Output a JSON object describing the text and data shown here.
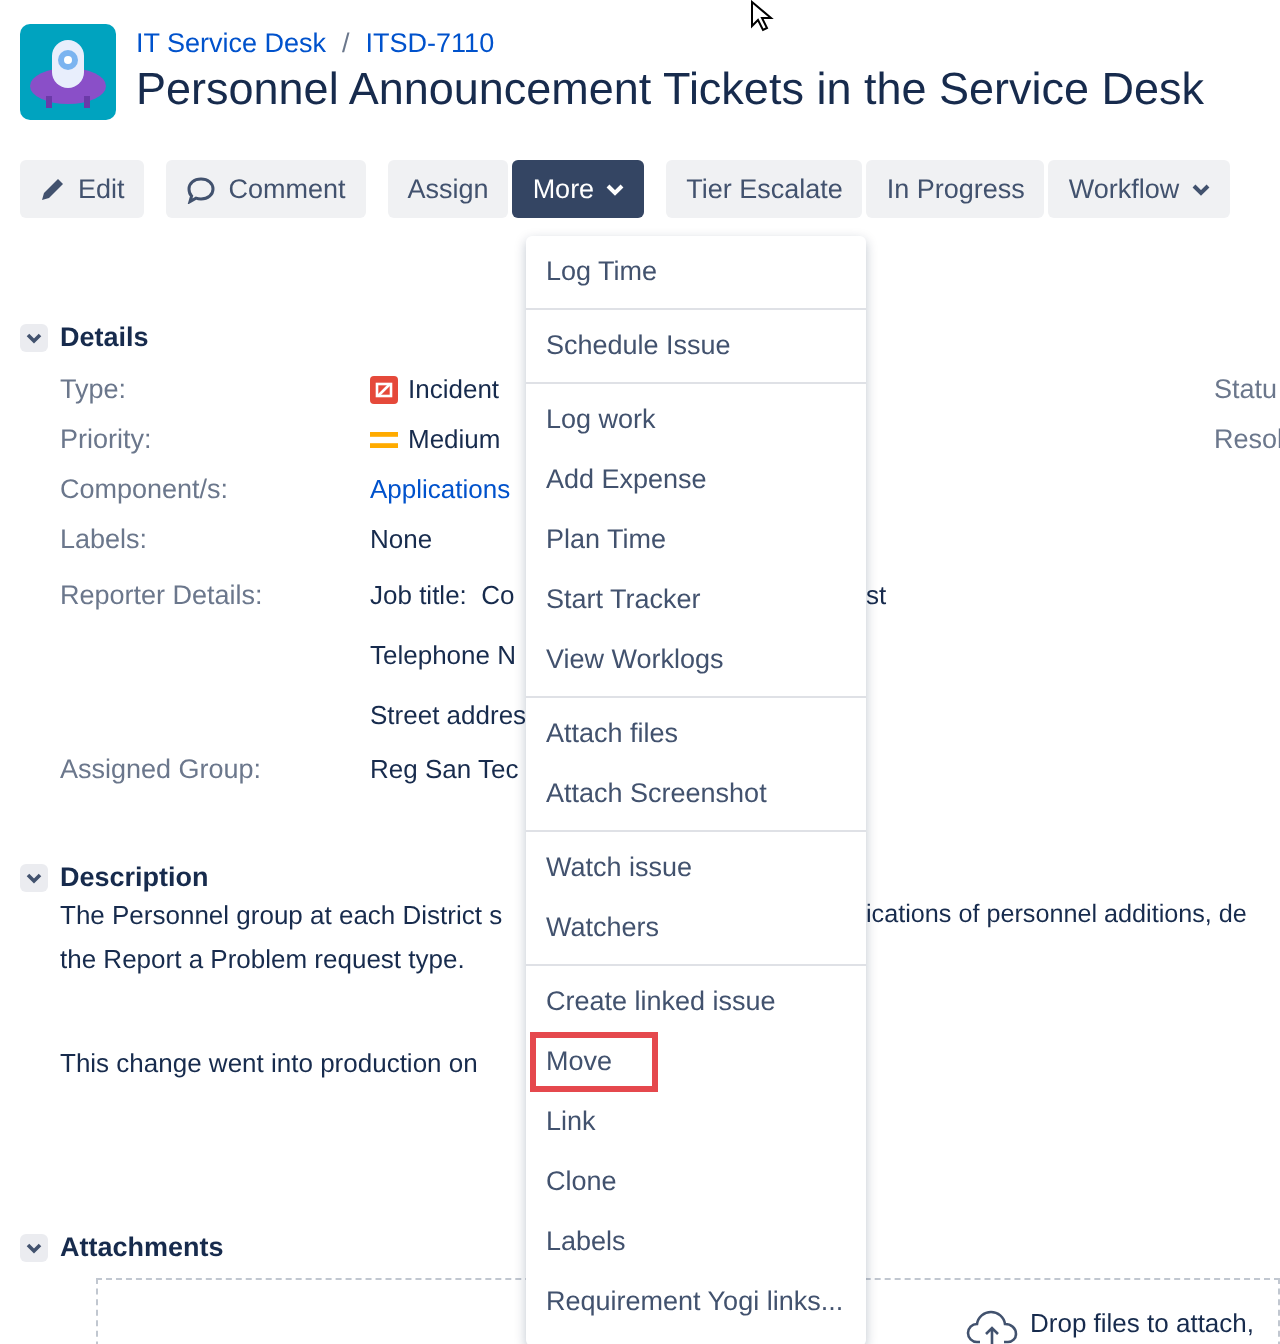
{
  "breadcrumbs": [
    {
      "text": "IT Service Desk"
    },
    {
      "text": "ITSD-7110"
    }
  ],
  "separator": "/",
  "title": "Personnel Announcement Tickets in the Service Desk",
  "toolbar": [
    {
      "label": "Edit",
      "selected": false
    },
    {
      "label": "Comment",
      "selected": false
    },
    {
      "label": "Assign",
      "selected": false
    },
    {
      "label": "More",
      "selected": true
    },
    {
      "label": "Tier Escalate",
      "selected": false
    },
    {
      "label": "In Progress",
      "selected": false
    },
    {
      "label": "Workflow",
      "selected": false
    }
  ],
  "details": {
    "title": "Details",
    "expanded": true,
    "rows": [
      {
        "label": "Type:",
        "value": "Incident",
        "right_label": "Statu"
      },
      {
        "label": "Priority:",
        "value": "Medium",
        "right_label": "Resol"
      },
      {
        "label": "Component/s:",
        "value": "Applications"
      },
      {
        "label": "Labels:",
        "value": "None"
      },
      {
        "label": "Reporter Details:",
        "value": "Job title:  Co",
        "after_menu": "st"
      },
      {
        "value": "Telephone N"
      },
      {
        "value": "Street addres"
      },
      {
        "label": "Assigned Group:",
        "value": "Reg San Tec"
      }
    ]
  },
  "description": {
    "title": "Description",
    "expanded": true,
    "lines": [
      {
        "before_menu": "The Personnel group at each District s",
        "after_menu": "ications of personnel additions, de"
      },
      {
        "before_menu": "the Report a Problem request type."
      },
      {
        "before_menu": "This change went into production on"
      }
    ]
  },
  "attachments": {
    "title": "Attachments",
    "expanded": true,
    "drop_text": "Drop files to attach,"
  },
  "menu": {
    "sections": [
      [
        {
          "label": "Log Time",
          "highlighted": false
        }
      ],
      [
        {
          "label": "Schedule Issue",
          "highlighted": false
        }
      ],
      [
        {
          "label": "Log work",
          "highlighted": false
        },
        {
          "label": "Add Expense",
          "highlighted": false
        },
        {
          "label": "Plan Time",
          "highlighted": false
        },
        {
          "label": "Start Tracker",
          "highlighted": false
        },
        {
          "label": "View Worklogs",
          "highlighted": false
        }
      ],
      [
        {
          "label": "Attach files",
          "highlighted": false
        },
        {
          "label": "Attach Screenshot",
          "highlighted": false
        }
      ],
      [
        {
          "label": "Watch issue",
          "highlighted": false
        },
        {
          "label": "Watchers",
          "highlighted": false
        }
      ],
      [
        {
          "label": "Create linked issue",
          "highlighted": false
        },
        {
          "label": "Move",
          "highlighted": true
        },
        {
          "label": "Link",
          "highlighted": false
        },
        {
          "label": "Clone",
          "highlighted": false
        },
        {
          "label": "Labels",
          "highlighted": false
        },
        {
          "label": "Requirement Yogi links...",
          "highlighted": false
        }
      ]
    ]
  }
}
